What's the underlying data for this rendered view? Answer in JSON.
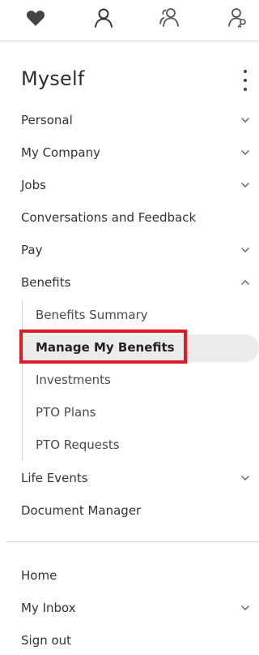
{
  "topbar": {
    "icons": [
      "heart-icon",
      "person-icon",
      "people-icon",
      "person-key-icon"
    ]
  },
  "menu": {
    "title": "Myself",
    "items": [
      {
        "label": "Personal",
        "chevron": "down"
      },
      {
        "label": "My Company",
        "chevron": "down"
      },
      {
        "label": "Jobs",
        "chevron": "down"
      },
      {
        "label": "Conversations and Feedback",
        "chevron": null
      },
      {
        "label": "Pay",
        "chevron": "down"
      },
      {
        "label": "Benefits",
        "chevron": "up"
      }
    ],
    "benefits_sub": [
      {
        "label": "Benefits Summary"
      },
      {
        "label": "Manage My Benefits",
        "active": true
      },
      {
        "label": "Investments"
      },
      {
        "label": "PTO Plans"
      },
      {
        "label": "PTO Requests"
      }
    ],
    "after": [
      {
        "label": "Life Events",
        "chevron": "down"
      },
      {
        "label": "Document Manager",
        "chevron": null
      }
    ]
  },
  "footer": {
    "items": [
      {
        "label": "Home",
        "chevron": null
      },
      {
        "label": "My Inbox",
        "chevron": "down"
      },
      {
        "label": "Sign out",
        "chevron": null
      }
    ]
  },
  "colors": {
    "highlight": "#e01b22",
    "active_bg": "#ececec"
  }
}
